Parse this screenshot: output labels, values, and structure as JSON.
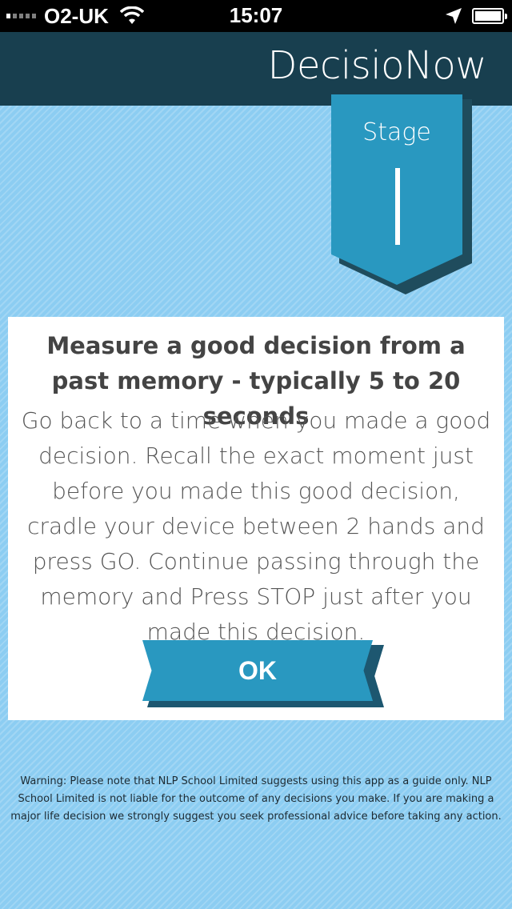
{
  "status_bar": {
    "carrier": "O2-UK",
    "time": "15:07",
    "signal_bars": 1,
    "battery_level": 1.0
  },
  "header": {
    "title": "DecisioNow"
  },
  "banner": {
    "label": "Stage",
    "number": "1"
  },
  "card": {
    "heading": "Measure a good decision from a past memory - typically 5 to 20 seconds",
    "body": "Go back to a time when you made a good decision. Recall the exact moment just before you made this good decision, cradle your device between 2 hands and press GO. Continue passing through the memory and Press STOP just after you made this decision.",
    "ok_label": "OK"
  },
  "warning": {
    "text": "Warning: Please note that NLP School Limited suggests using this app as a guide only. NLP School Limited is not liable for the outcome of any decisions you make. If you are making a major life decision we strongly suggest you seek professional advice before taking any action."
  },
  "colors": {
    "header_bg": "#183f4f",
    "accent": "#2998c0",
    "background": "#8ccdf2"
  },
  "icons": {
    "wifi": "wifi-icon",
    "location": "location-arrow-icon",
    "battery": "battery-icon"
  }
}
